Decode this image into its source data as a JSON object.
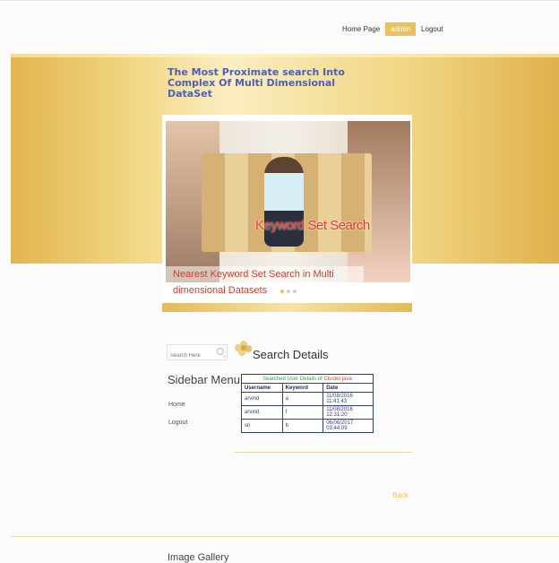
{
  "nav": {
    "home": "Home Page",
    "admin": "admin",
    "logout": "Logout"
  },
  "header": {
    "title": "The Most Proximate search Into Complex Of Multi Dimensional DataSet"
  },
  "slider": {
    "slide_label": "Keyword Set Search",
    "caption": "Nearest Keyword Set Search in Multi dimensional Datasets",
    "active_dot": 1
  },
  "search": {
    "placeholder": "Search Here"
  },
  "sidebar": {
    "title": "Sidebar Menu",
    "items": [
      {
        "label": "Home"
      },
      {
        "label": "Logout"
      }
    ]
  },
  "details": {
    "title": "Search Details",
    "caption_prefix": "Searched User Details of",
    "caption_owner": "Cluster.java",
    "columns": [
      "Username",
      "Keyword",
      "Date"
    ],
    "rows": [
      [
        "arvind",
        "a",
        "11/08/2016 11:41:43"
      ],
      [
        "arvind",
        "f",
        "11/08/2016 12:31:20"
      ],
      [
        "sri",
        "b",
        "06/06/2017 03:44:09"
      ]
    ]
  },
  "back": "Back",
  "footer": {
    "gallery_title": "Image Gallery"
  },
  "colors": {
    "accent": "#e9c35a",
    "link": "#2e3f86",
    "title": "#4b5fb8",
    "caption_red": "#d83b25"
  }
}
